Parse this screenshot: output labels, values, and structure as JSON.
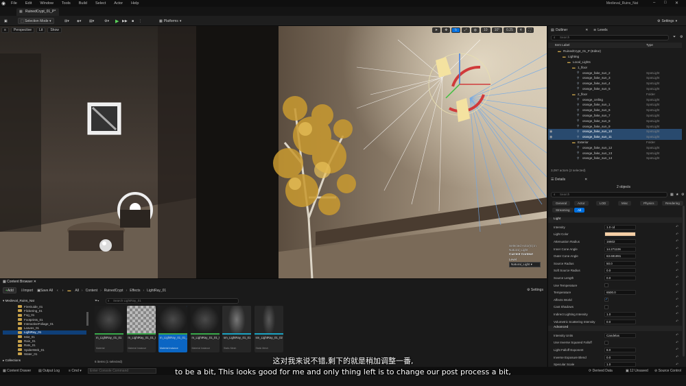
{
  "menu": {
    "items": [
      "File",
      "Edit",
      "Window",
      "Tools",
      "Build",
      "Select",
      "Actor",
      "Help"
    ],
    "project": "Medieval_Ruins_Nat"
  },
  "tab": {
    "label": "RuinedCrypt_01_P*"
  },
  "toolbar": {
    "selection_mode": "Selection Mode",
    "platforms": "Platforms",
    "settings": "Settings"
  },
  "viewport": {
    "perspective": "Perspective",
    "lit": "Lit",
    "show": "Show",
    "grid_snap": "10",
    "rot_snap": "10°",
    "scale_snap": "0.25",
    "cam_speed": "4",
    "selected_actors": "Selected Actor(s) in",
    "selected_level_name": "Natural_Light",
    "current_context": "Current Context",
    "level_label": "Level",
    "level_value": "Natural_Light"
  },
  "outliner": {
    "tab_outliner": "Outliner",
    "tab_levels": "Levels",
    "search_placeholder": "Search",
    "col_label": "Item Label",
    "col_type": "Type",
    "footer": "3,097 actors (2 selected)",
    "rows": [
      {
        "name": "RuinedCrypt_01_P (Editor)",
        "type": "",
        "indent": 0,
        "sel": false,
        "eye": false
      },
      {
        "name": "Lighting",
        "type": "",
        "indent": 1,
        "sel": false,
        "eye": false
      },
      {
        "name": "Local_Lights",
        "type": "",
        "indent": 2,
        "sel": false,
        "eye": false
      },
      {
        "name": "1_floor",
        "type": "",
        "indent": 3,
        "sel": false,
        "eye": false
      },
      {
        "name": "orange_fake_sun_2",
        "type": "SpotLight",
        "indent": 4,
        "sel": false,
        "eye": false
      },
      {
        "name": "orange_fake_sun_3",
        "type": "SpotLight",
        "indent": 4,
        "sel": false,
        "eye": false
      },
      {
        "name": "orange_fake_sun_4",
        "type": "SpotLight",
        "indent": 4,
        "sel": false,
        "eye": false
      },
      {
        "name": "orange_fake_sun_5",
        "type": "SpotLight",
        "indent": 4,
        "sel": false,
        "eye": false
      },
      {
        "name": "2_floor",
        "type": "Folder",
        "indent": 3,
        "sel": false,
        "eye": false
      },
      {
        "name": "orange_ceiling",
        "type": "SpotLight",
        "indent": 4,
        "sel": false,
        "eye": false
      },
      {
        "name": "orange_fake_sun_1",
        "type": "SpotLight",
        "indent": 4,
        "sel": false,
        "eye": false
      },
      {
        "name": "orange_fake_sun_6",
        "type": "SpotLight",
        "indent": 4,
        "sel": false,
        "eye": false
      },
      {
        "name": "orange_fake_sun_7",
        "type": "SpotLight",
        "indent": 4,
        "sel": false,
        "eye": false
      },
      {
        "name": "orange_fake_sun_8",
        "type": "SpotLight",
        "indent": 4,
        "sel": false,
        "eye": false
      },
      {
        "name": "orange_fake_sun_9",
        "type": "SpotLight",
        "indent": 4,
        "sel": false,
        "eye": false
      },
      {
        "name": "orange_fake_sun_10",
        "type": "SpotLight",
        "indent": 4,
        "sel": true,
        "eye": true
      },
      {
        "name": "orange_fake_sun_11",
        "type": "SpotLight",
        "indent": 4,
        "sel": true,
        "eye": true
      },
      {
        "name": "Exterior",
        "type": "Folder",
        "indent": 3,
        "sel": false,
        "eye": false
      },
      {
        "name": "orange_fake_sun_12",
        "type": "SpotLight",
        "indent": 4,
        "sel": false,
        "eye": false
      },
      {
        "name": "orange_fake_sun_13",
        "type": "SpotLight",
        "indent": 4,
        "sel": false,
        "eye": false
      },
      {
        "name": "orange_fake_sun_14",
        "type": "SpotLight",
        "indent": 4,
        "sel": false,
        "eye": false
      }
    ]
  },
  "details": {
    "tab": "Details",
    "objects": "2 objects",
    "search_placeholder": "Search",
    "cats_row1": [
      "General",
      "Actor",
      "LOD",
      "Misc",
      "Physics",
      "Rendering"
    ],
    "cats_row2": [
      "Streaming",
      "All"
    ],
    "section_light": "Light",
    "section_advanced": "Advanced",
    "props": [
      {
        "label": "Intensity",
        "value": "1.0 cd",
        "kind": "text"
      },
      {
        "label": "Light Color",
        "value": "",
        "kind": "color",
        "color": "#f5cfa6"
      },
      {
        "label": "Attenuation Radius",
        "value": "16602",
        "kind": "text"
      },
      {
        "label": "Inner Cone Angle",
        "value": "14.271106",
        "kind": "text"
      },
      {
        "label": "Outer Cone Angle",
        "value": "63.691991",
        "kind": "text"
      },
      {
        "label": "Source Radius",
        "value": "50.0",
        "kind": "text"
      },
      {
        "label": "Soft Source Radius",
        "value": "0.0",
        "kind": "text"
      },
      {
        "label": "Source Length",
        "value": "0.0",
        "kind": "text"
      },
      {
        "label": "Use Temperature",
        "value": "",
        "kind": "check",
        "checked": false
      },
      {
        "label": "Temperature",
        "value": "6500.0",
        "kind": "text"
      },
      {
        "label": "Affects World",
        "value": "",
        "kind": "check",
        "checked": true
      },
      {
        "label": "Cast Shadows",
        "value": "",
        "kind": "check",
        "checked": false
      },
      {
        "label": "Indirect Lighting Intensity",
        "value": "1.0",
        "kind": "text"
      },
      {
        "label": "Volumetric Scattering Intensity",
        "value": "0.0",
        "kind": "text"
      }
    ],
    "adv_props": [
      {
        "label": "Intensity Units",
        "value": "Candelas",
        "kind": "text"
      },
      {
        "label": "Use Inverse Squared Falloff",
        "value": "",
        "kind": "check",
        "checked": false
      },
      {
        "label": "Light Falloff Exponent",
        "value": "8.0",
        "kind": "text"
      },
      {
        "label": "Inverse Exposure Blend",
        "value": "0.0",
        "kind": "text"
      },
      {
        "label": "Specular Scale",
        "value": "1.0",
        "kind": "text"
      }
    ]
  },
  "content_browser": {
    "tab": "Content Browser",
    "add": "Add",
    "import": "Import",
    "save_all": "Save All",
    "breadcrumb": [
      "All",
      "Content",
      "RuinedCrypt",
      "Effects",
      "LightRay_01"
    ],
    "settings": "Settings",
    "root_folder": "Medieval_Ruins_Nat",
    "search_placeholder": "Search LightRay_01",
    "folders": [
      "FireGuide_01",
      "Flickering_01",
      "Fog_01",
      "Footprints_01",
      "InteractiveFoliage_01",
      "Leaves_01",
      "LightRay_01",
      "Mist_01",
      "Rain_01",
      "Rats_01",
      "SpiderWeb_01",
      "Water_01"
    ],
    "collections": "Collections",
    "item_count": "6 items (1 selected)",
    "assets": [
      {
        "name": "m_LightRay_01_01",
        "type": "Material",
        "thumb": "dark",
        "sel": false
      },
      {
        "name": "m_LightRay_01_01_Blue",
        "type": "Material Instance",
        "thumb": "checker",
        "sel": false
      },
      {
        "name": "m_LightRay_01_01_Add",
        "type": "Material Instance",
        "thumb": "dark",
        "sel": true
      },
      {
        "name": "m_LightRay_01_01_Mesh",
        "type": "Material Instance",
        "thumb": "dark",
        "sel": false
      },
      {
        "name": "sm_LightRay_01_01",
        "type": "Static Mesh",
        "thumb": "ray",
        "sel": false
      },
      {
        "name": "sm_LightRay_01_02",
        "type": "Static Mesh",
        "thumb": "ray2",
        "sel": false
      }
    ]
  },
  "status": {
    "content_drawer": "Content Drawer",
    "output_log": "Output Log",
    "cmd": "Cmd",
    "console_placeholder": "Enter Console Command",
    "derived_data": "Derived Data",
    "unsaved": "12 Unsaved",
    "source_control": "Source Control"
  },
  "subtitles": {
    "zh": "这对我来说不错,剩下的就是稍加调整一番,",
    "en": "to be a bit, This looks good for me and only thing left is to change our post process a bit,"
  }
}
